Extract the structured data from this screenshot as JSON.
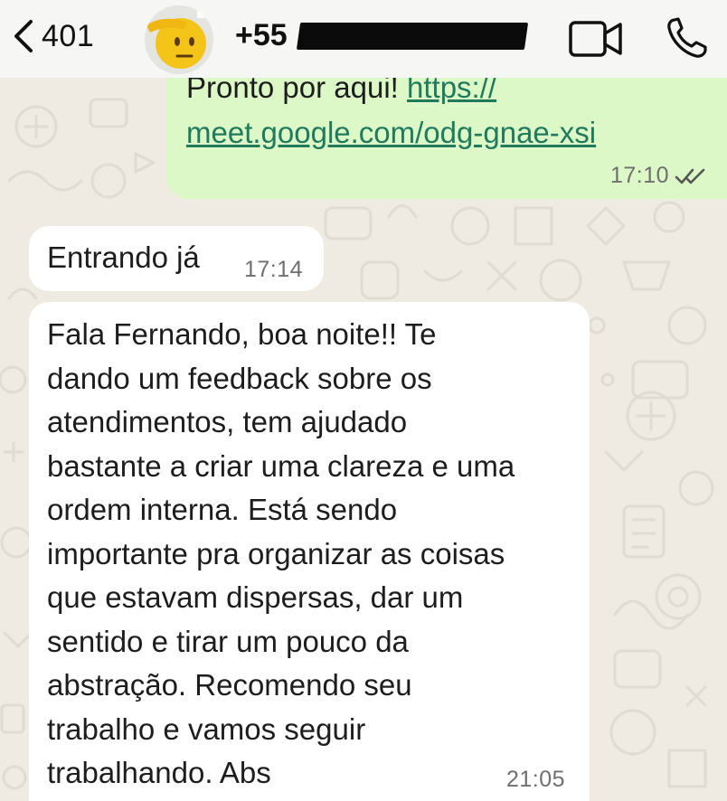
{
  "header": {
    "back_count": "401",
    "contact_prefix": "+55",
    "icons": {
      "back": "chevron-left-icon",
      "video": "video-camera-icon",
      "call": "phone-icon"
    }
  },
  "messages": [
    {
      "direction": "outgoing",
      "text_prefix": "Pronto por aqui! ",
      "link_part1": "https://",
      "link_part2": "meet.google.com/odg-gnae-xsi",
      "time": "17:10",
      "status": "read"
    },
    {
      "direction": "incoming",
      "text": "Entrando já",
      "time": "17:14"
    },
    {
      "direction": "incoming",
      "lines": [
        "Fala Fernando, boa noite!! Te",
        "dando um feedback sobre os",
        "atendimentos, tem ajudado",
        "bastante a criar uma clareza e uma",
        "ordem interna. Está sendo",
        "importante pra organizar as coisas",
        "que estavam dispersas, dar um",
        "sentido e tirar um pouco da",
        "abstração. Recomendo seu",
        "trabalho e vamos seguir",
        "trabalhando. Abs"
      ],
      "time": "21:05"
    }
  ],
  "colors": {
    "background": "#efeae2",
    "outgoing_bubble": "#dcf8c6",
    "incoming_bubble": "#ffffff",
    "link": "#1f7a5e"
  }
}
